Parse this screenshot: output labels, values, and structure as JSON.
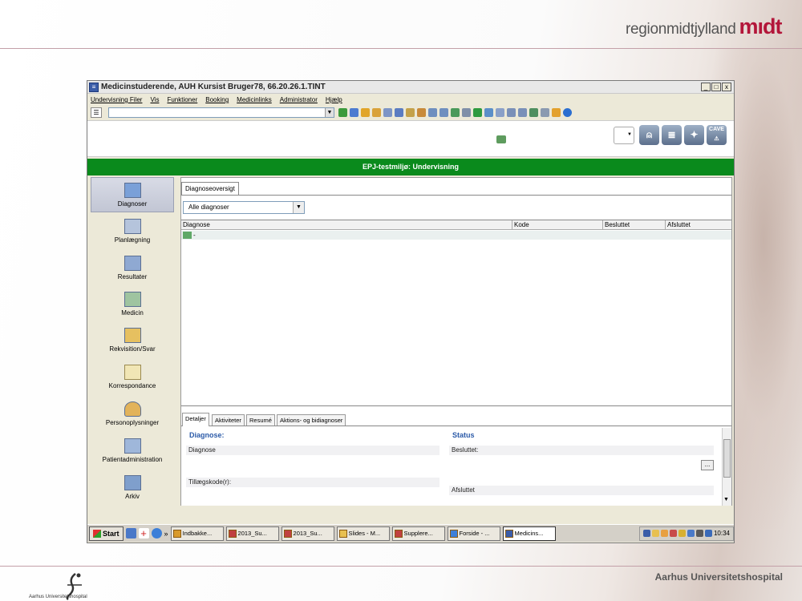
{
  "slide": {
    "brand_text": "regionmidtjylland",
    "brand_mark": "mıdt",
    "footer_right": "Aarhus Universitetshospital",
    "footer_logo_text": "Aarhus Universitetshospital"
  },
  "window": {
    "title": "Medicinstuderende, AUH Kursist Bruger78, 66.20.26.1.TINT",
    "buttons": [
      "_",
      "□",
      "x"
    ]
  },
  "menu": [
    "Undervisning Filer",
    "Vis",
    "Funktioner",
    "Booking",
    "Medicinlinks",
    "Administrator",
    "Hjælp"
  ],
  "banner": "EPJ-testmiljø: Undervisning",
  "right_panel": {
    "cave_label": "CAVE"
  },
  "nav": [
    {
      "label": "Diagnoser",
      "active": true
    },
    {
      "label": "Planlægning",
      "active": false
    },
    {
      "label": "Resultater",
      "active": false
    },
    {
      "label": "Medicin",
      "active": false
    },
    {
      "label": "Rekvisition/Svar",
      "active": false
    },
    {
      "label": "Korrespondance",
      "active": false
    },
    {
      "label": "Personoplysninger",
      "active": false
    },
    {
      "label": "Patientadministration",
      "active": false
    },
    {
      "label": "Arkiv",
      "active": false
    }
  ],
  "content": {
    "tab": "Diagnoseoversigt",
    "filter": "Alle diagnoser",
    "columns": [
      "Diagnose",
      "Kode",
      "Besluttet",
      "Afsluttet"
    ],
    "rows": [
      {
        "diagnose": "-"
      }
    ],
    "bottom_tabs": [
      "Detaljer",
      "Aktiviteter",
      "Resumé",
      "Aktions- og bidiagnoser"
    ],
    "details": {
      "heading_left": "Diagnose:",
      "heading_right": "Status",
      "diagnose_label": "Diagnose",
      "tillaeg_label": "Tillægskode(r):",
      "besluttet_label": "Besluttet:",
      "afsluttet_label": "Afsluttet",
      "more_button": "..."
    }
  },
  "taskbar": {
    "start": "Start",
    "chevron": "»",
    "tasks": [
      {
        "label": "Indbakke...",
        "active": false
      },
      {
        "label": "2013_Su...",
        "active": false
      },
      {
        "label": "2013_Su...",
        "active": false
      },
      {
        "label": "Slides - M...",
        "active": false
      },
      {
        "label": "Supplere...",
        "active": false
      },
      {
        "label": "Forside - ...",
        "active": false
      },
      {
        "label": "Medicins...",
        "active": true
      }
    ],
    "clock": "10:34"
  }
}
